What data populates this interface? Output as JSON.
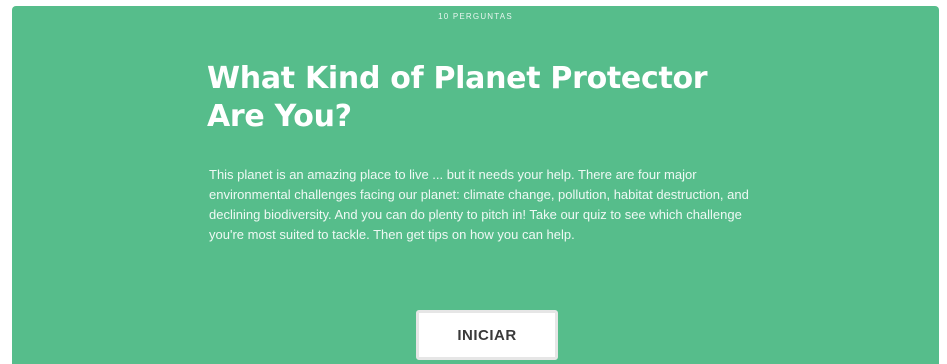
{
  "quiz": {
    "question_count": "10 PERGUNTAS",
    "title": "What Kind of Planet Protector Are You?",
    "description": "This planet is an amazing place to live ... but it needs your help. There are four major environmental challenges facing our planet: climate change, pollution, habitat destruction, and declining biodiversity. And you can do plenty to pitch in! Take our quiz to see which challenge you're most suited to tackle. Then get tips on how you can help.",
    "start_label": "INICIAR"
  },
  "colors": {
    "card_background": "#56bd8b",
    "title_text": "#ffffff",
    "button_background": "#ffffff",
    "button_text": "#3a3a3a"
  }
}
